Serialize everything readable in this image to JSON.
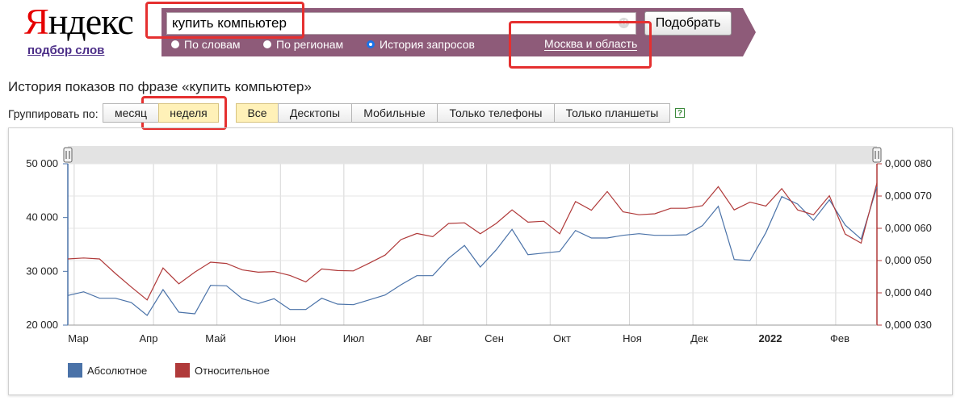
{
  "header": {
    "logo_first": "Я",
    "logo_rest": "ндекс",
    "sublink": "подбор слов",
    "search_value": "купить компьютер",
    "search_button": "Подобрать",
    "modes": [
      {
        "label": "По словам",
        "selected": false
      },
      {
        "label": "По регионам",
        "selected": false
      },
      {
        "label": "История запросов",
        "selected": true
      }
    ],
    "region": "Москва и область",
    "bar_color": "#8e5b79"
  },
  "main": {
    "heading": "История показов по фразе «купить компьютер»",
    "group_label": "Группировать по:",
    "group_buttons": [
      {
        "label": "месяц",
        "active": false
      },
      {
        "label": "неделя",
        "active": true
      }
    ],
    "device_buttons": [
      {
        "label": "Все",
        "active": true
      },
      {
        "label": "Десктопы",
        "active": false
      },
      {
        "label": "Мобильные",
        "active": false
      },
      {
        "label": "Только телефоны",
        "active": false
      },
      {
        "label": "Только планшеты",
        "active": false
      }
    ],
    "help": "?"
  },
  "chart_data": {
    "type": "line",
    "x_labels": [
      "Мар",
      "Апр",
      "Май",
      "Июн",
      "Июл",
      "Авг",
      "Сен",
      "Окт",
      "Ноя",
      "Дек",
      "2022",
      "Фев"
    ],
    "y_left": {
      "ticks": [
        "20 000",
        "30 000",
        "40 000",
        "50 000"
      ],
      "min": 20000,
      "max": 50000
    },
    "y_right": {
      "ticks": [
        "0,000 030",
        "0,000 040",
        "0,000 050",
        "0,000 060",
        "0,000 070",
        "0,000 080"
      ],
      "min": 3e-05,
      "max": 8e-05
    },
    "grid": true,
    "legend_position": "bottom-left",
    "series": [
      {
        "name": "Абсолютное",
        "color": "#4a72a8",
        "axis": "left",
        "values": [
          25500,
          26200,
          25000,
          25000,
          24200,
          21800,
          26600,
          22400,
          22100,
          27400,
          27300,
          24900,
          24000,
          24900,
          22900,
          22900,
          25000,
          23900,
          23800,
          24700,
          25600,
          27500,
          29200,
          29200,
          32400,
          34800,
          30800,
          34000,
          37800,
          33100,
          33400,
          33700,
          37600,
          36200,
          36200,
          36700,
          37000,
          36700,
          36700,
          36800,
          38500,
          42100,
          32200,
          32000,
          37200,
          43900,
          42500,
          39500,
          43300,
          38600,
          36000,
          45700
        ]
      },
      {
        "name": "Относительное",
        "color": "#b03a3a",
        "axis": "right",
        "values": [
          5.05e-05,
          5.08e-05,
          5.05e-05,
          4.6e-05,
          4.18e-05,
          3.78e-05,
          4.77e-05,
          4.28e-05,
          4.64e-05,
          4.95e-05,
          4.91e-05,
          4.71e-05,
          4.64e-05,
          4.66e-05,
          4.54e-05,
          4.34e-05,
          4.74e-05,
          4.69e-05,
          4.68e-05,
          4.92e-05,
          5.17e-05,
          5.65e-05,
          5.84e-05,
          5.74e-05,
          6.15e-05,
          6.17e-05,
          5.83e-05,
          6.15e-05,
          6.57e-05,
          6.19e-05,
          6.22e-05,
          5.83e-05,
          6.83e-05,
          6.56e-05,
          7.14e-05,
          6.51e-05,
          6.42e-05,
          6.45e-05,
          6.62e-05,
          6.62e-05,
          6.7e-05,
          7.29e-05,
          6.57e-05,
          6.81e-05,
          6.69e-05,
          7.23e-05,
          6.57e-05,
          6.42e-05,
          7.01e-05,
          5.82e-05,
          5.54e-05,
          7.41e-05
        ]
      }
    ]
  }
}
